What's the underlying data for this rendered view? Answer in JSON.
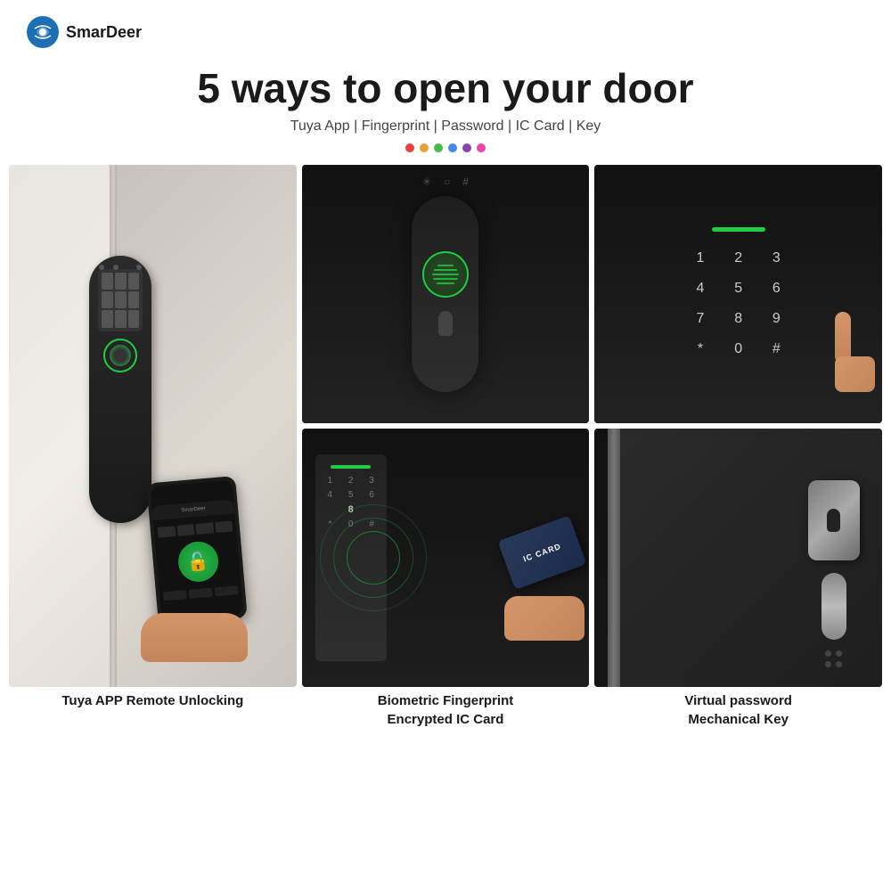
{
  "brand": {
    "name": "SmarDeer",
    "logo_color": "#1a6fb5"
  },
  "title": {
    "main": "5 ways to open your door",
    "subtitle": "Tuya App | Fingerprint | Password | IC Card | Key"
  },
  "dots": [
    {
      "color": "#e84040"
    },
    {
      "color": "#e8a030"
    },
    {
      "color": "#44bb44"
    },
    {
      "color": "#4488ee"
    },
    {
      "color": "#884488"
    },
    {
      "color": "#ee44aa"
    }
  ],
  "images": {
    "large_left": {
      "alt": "Tuya app remote unlocking door lock with phone"
    },
    "top_middle": {
      "alt": "Biometric fingerprint scanner on smart lock"
    },
    "top_right": {
      "alt": "Virtual password keypad on smart lock"
    },
    "bottom_middle": {
      "alt": "IC card being used on smart lock"
    },
    "bottom_right": {
      "alt": "Mechanical key cylinder on door"
    }
  },
  "captions": {
    "large_left": "Tuya APP Remote Unlocking",
    "top_middle": "Biometric Fingerprint",
    "top_right": "Virtual password",
    "bottom_middle": "Encrypted IC Card",
    "bottom_right": "Mechanical Key"
  },
  "ic_card_label": "IC CARD",
  "numpad": {
    "keys": [
      "1",
      "2",
      "3",
      "4",
      "5",
      "6",
      "7",
      "8",
      "9",
      "*",
      "0",
      "#"
    ]
  }
}
